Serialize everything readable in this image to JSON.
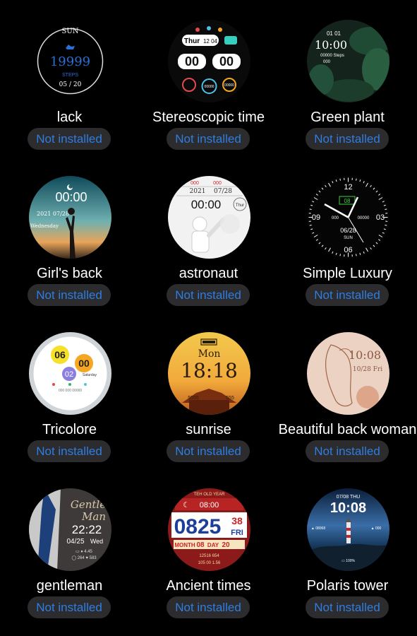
{
  "button_label": "Not installed",
  "faces": [
    {
      "name": "lack",
      "texts": [
        "SUN",
        "19999",
        "STEPS",
        "05 / 20"
      ]
    },
    {
      "name": "Stereoscopic time",
      "texts": [
        "Thur",
        "12 04",
        "00",
        "00",
        "00000",
        "00000"
      ]
    },
    {
      "name": "Green plant",
      "texts": [
        "01 01",
        "10:00",
        "00000 Steps",
        "000"
      ]
    },
    {
      "name": "Girl's back",
      "texts": [
        "00:00",
        "2021 07/28",
        "Wednesday"
      ]
    },
    {
      "name": "astronaut",
      "texts": [
        "000",
        "000",
        "2021",
        "07/28",
        "00:00",
        "Thur"
      ]
    },
    {
      "name": "Simple Luxury",
      "texts": [
        "12",
        "09",
        "03",
        "06",
        "08",
        "000",
        "00000",
        "06/28",
        "SUN"
      ]
    },
    {
      "name": "Tricolore",
      "texts": [
        "06",
        "00",
        "02",
        "Saturday"
      ]
    },
    {
      "name": "sunrise",
      "texts": [
        "Mon",
        "18:18",
        "5555",
        "555"
      ]
    },
    {
      "name": "Beautiful back woman",
      "texts": [
        "10:08",
        "10/28 Fri"
      ]
    },
    {
      "name": "gentleman",
      "texts": [
        "Gentle",
        "Man",
        "22:22",
        "04/25",
        "Wed"
      ]
    },
    {
      "name": "Ancient times",
      "texts": [
        "TEH OLD YEAR",
        "08:00",
        "0825",
        "38",
        "FRI",
        "MONTH",
        "08",
        "DAY",
        "20"
      ]
    },
    {
      "name": "Polaris tower",
      "texts": [
        "07/08 THU",
        "10:08"
      ]
    }
  ],
  "colors": {
    "background": "#000000",
    "button_bg": "#2c2c2e",
    "button_text": "#2f7de1",
    "title_text": "#ffffff"
  }
}
